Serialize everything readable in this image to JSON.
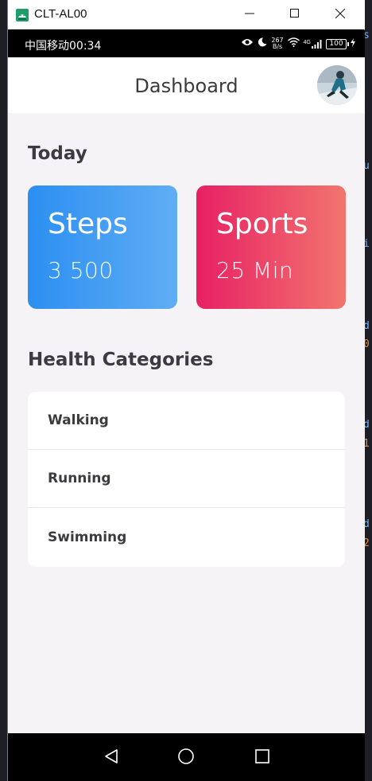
{
  "window": {
    "title": "CLT-AL00",
    "icon": "android-icon",
    "controls": [
      "minimize-icon",
      "maximize-icon",
      "close-icon"
    ]
  },
  "status_bar": {
    "carrier_time": "中国移动00:34",
    "net_speed_top": "267",
    "net_speed_bottom": "B/s",
    "signal_label": "4G",
    "battery": "100",
    "icons": [
      "eye-icon",
      "moon-icon",
      "wifi-icon",
      "signal-icon",
      "battery-icon",
      "charging-icon"
    ]
  },
  "header": {
    "title": "Dashboard",
    "avatar": "avatar-icon"
  },
  "today": {
    "heading": "Today",
    "cards": [
      {
        "title": "Steps",
        "value": "3 500",
        "gradient": [
          "#2b8ff1",
          "#60adf4"
        ]
      },
      {
        "title": "Sports",
        "value": "25 Min",
        "gradient": [
          "#e72064",
          "#f2756e"
        ]
      }
    ]
  },
  "categories": {
    "heading": "Health Categories",
    "items": [
      {
        "label": "Walking"
      },
      {
        "label": "Running"
      },
      {
        "label": "Swimming"
      }
    ]
  },
  "nav_bar": {
    "buttons": [
      "back-icon",
      "home-icon",
      "recents-icon"
    ]
  },
  "colors": {
    "background": "#f5f3f6",
    "heading": "#3c3b3f",
    "card": "#ffffff"
  },
  "ide_strip": {
    "chars": [
      {
        "t": "s",
        "c": "#6fb3ff"
      },
      {
        "t": "u",
        "c": "#6fb3ff"
      },
      {
        "t": "i",
        "c": "#6fb3ff"
      },
      {
        "t": "d",
        "c": "#6fb3ff"
      },
      {
        "t": "0",
        "c": "#e8893d"
      },
      {
        "t": "d",
        "c": "#6fb3ff"
      },
      {
        "t": "1",
        "c": "#e8893d"
      },
      {
        "t": "d",
        "c": "#6fb3ff"
      },
      {
        "t": "2",
        "c": "#e8893d"
      }
    ]
  }
}
